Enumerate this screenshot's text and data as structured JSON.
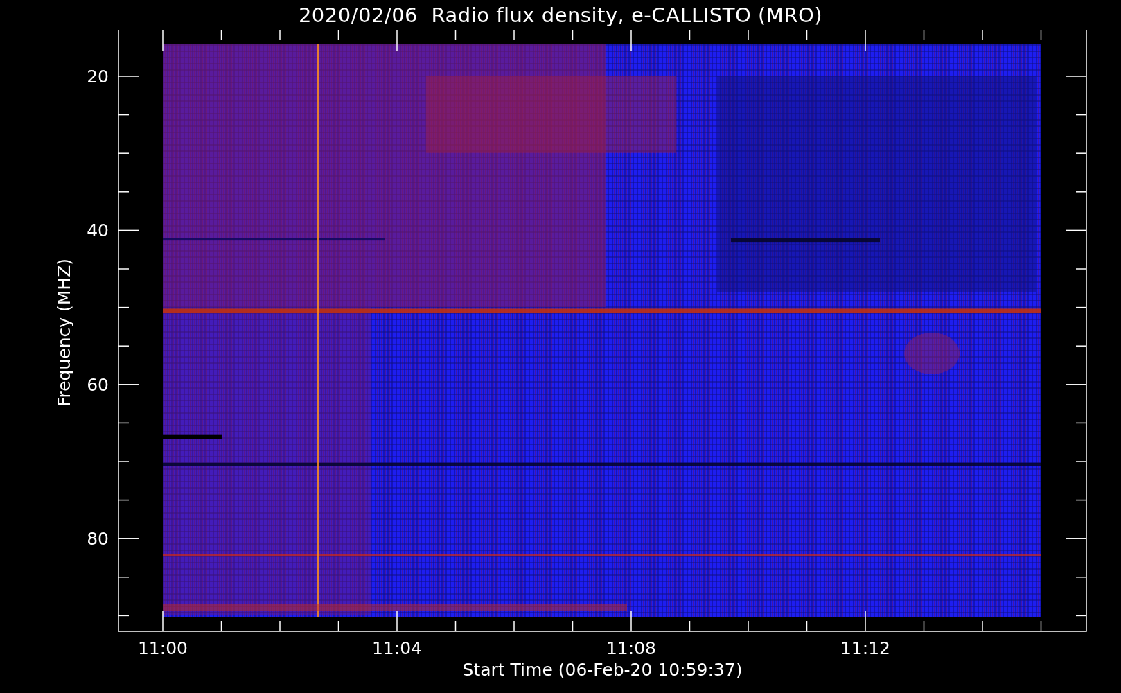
{
  "title": "2020/02/06  Radio flux density, e-CALLISTO (MRO)",
  "plot": {
    "y_axis": {
      "label": "Frequency (MHZ)",
      "ticks": [
        "20",
        "40",
        "60",
        "80"
      ]
    },
    "x_axis": {
      "label": "Start Time (06-Feb-20 10:59:37)",
      "ticks": [
        "11:00",
        "11:04",
        "11:08",
        "11:12"
      ]
    }
  }
}
